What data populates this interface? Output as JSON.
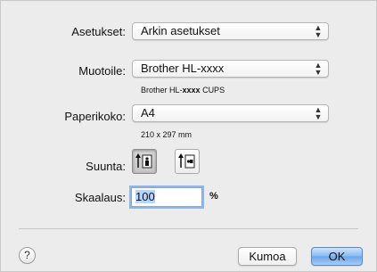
{
  "settings": {
    "label": "Asetukset:",
    "value": "Arkin asetukset"
  },
  "format_for": {
    "label": "Muotoile:",
    "value": "Brother HL-xxxx",
    "subtext_prefix": "Brother HL-",
    "subtext_bold": "xxxx",
    "subtext_suffix": " CUPS"
  },
  "paper_size": {
    "label": "Paperikoko:",
    "value": "A4",
    "dimensions": "210 x 297 mm"
  },
  "orientation": {
    "label": "Suunta:",
    "selected": "portrait"
  },
  "scale": {
    "label": "Skaalaus:",
    "value": "100",
    "unit": "%"
  },
  "footer": {
    "help_label": "?",
    "cancel_label": "Kumoa",
    "ok_label": "OK"
  },
  "popup_arrows": "⌃⌄",
  "colors": {
    "default_button": "#6aa6ee",
    "focus_ring": "#8bb7f0"
  }
}
